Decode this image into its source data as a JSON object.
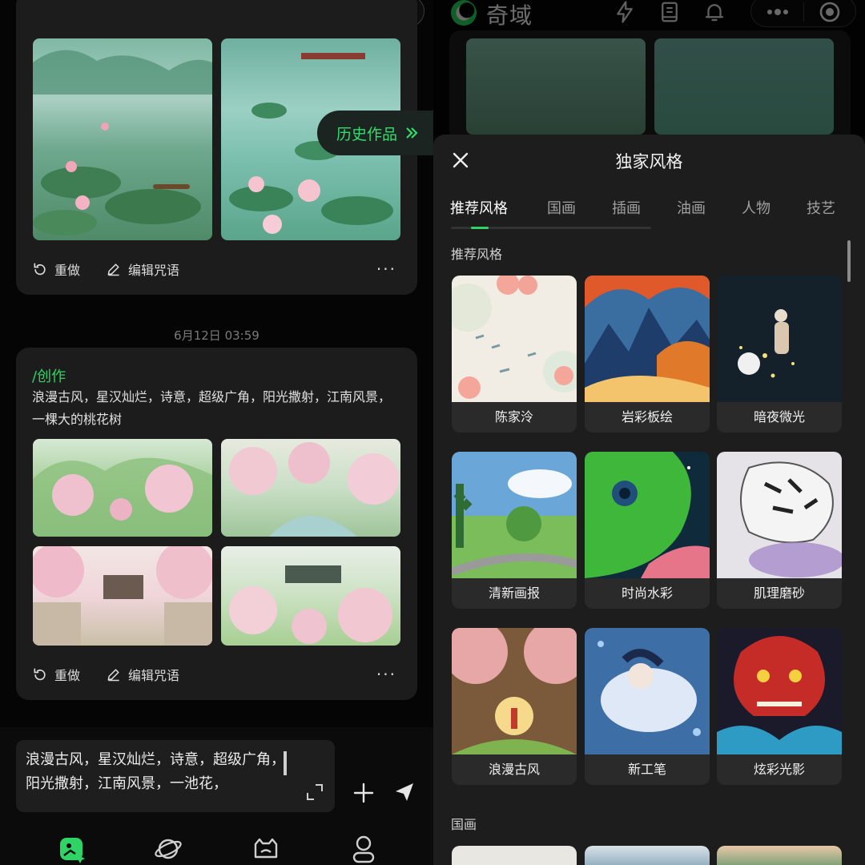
{
  "app": {
    "name": "奇域"
  },
  "left": {
    "history_button": "历史作品",
    "card1": {
      "redo": "重做",
      "edit": "编辑咒语",
      "more": "···"
    },
    "timestamp": "6月12日 03:59",
    "card2": {
      "command": "/创作",
      "prompt": "浪漫古风，星汉灿烂，诗意，超级广角，阳光撒射，江南风景，一棵大的桃花树",
      "redo": "重做",
      "edit": "编辑咒语",
      "more": "···"
    },
    "input": {
      "text": "浪漫古风，星汉灿烂，诗意，超级广角，阳光撒射，江南风景，一池花，"
    }
  },
  "right": {
    "sheet_title": "独家风格",
    "tabs": [
      "推荐风格",
      "国画",
      "插画",
      "油画",
      "人物",
      "技艺"
    ],
    "section_recommended": "推荐风格",
    "styles": [
      "陈家泠",
      "岩彩板绘",
      "暗夜微光",
      "清新画报",
      "时尚水彩",
      "肌理磨砂",
      "浪漫古风",
      "新工笔",
      "炫彩光影"
    ],
    "section_guohua": "国画"
  },
  "colors": {
    "accent": "#2fd466",
    "background": "#050505",
    "card": "#1c1c1c",
    "sheet": "#1d1d1d"
  },
  "icons": [
    "lightning-icon",
    "notebook-icon",
    "bell-icon",
    "more-dots-icon",
    "record-icon",
    "redo-icon",
    "edit-icon",
    "expand-icon",
    "plus-icon",
    "send-icon",
    "create-tab-icon",
    "planet-tab-icon",
    "bot-tab-icon",
    "profile-tab-icon",
    "close-icon"
  ]
}
